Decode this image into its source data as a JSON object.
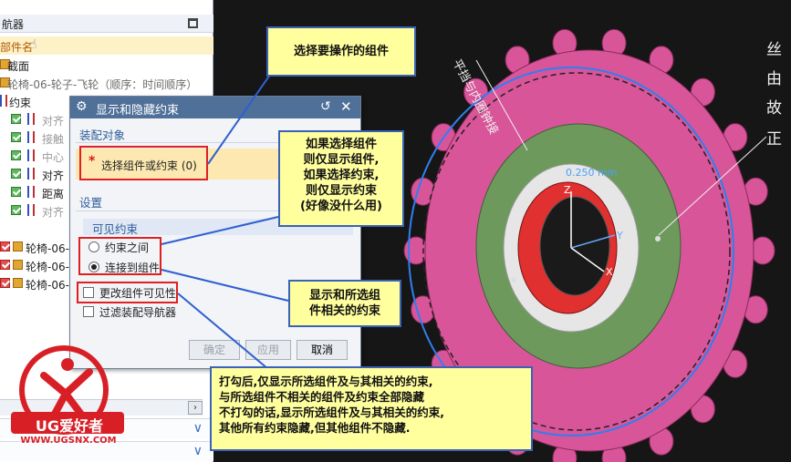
{
  "navigator": {
    "title": "航器",
    "rows": [
      {
        "label": "部件名"
      },
      {
        "label": "截面"
      },
      {
        "label": "轮椅-06-轮子-飞轮（顺序：时间顺序）"
      },
      {
        "label": "约束"
      },
      {
        "label": "对齐"
      },
      {
        "label": "接触"
      },
      {
        "label": "中心"
      },
      {
        "label": "对齐"
      },
      {
        "label": "距离"
      },
      {
        "label": "对齐"
      },
      {
        "label": "轮椅-06-"
      },
      {
        "label": "轮椅-06-"
      },
      {
        "label": "轮椅-06-"
      }
    ]
  },
  "dialog": {
    "title": "显示和隐藏约束",
    "section_assembly": "装配对象",
    "select_label": "选择组件或约束 (0)",
    "section_settings": "设置",
    "visible_constraints": "可见约束",
    "radio_between": "约束之间",
    "radio_connected": "连接到组件",
    "checkbox_change_visibility": "更改组件可见性",
    "checkbox_filter": "过滤装配导航器",
    "btn_ok": "确定",
    "btn_apply": "应用",
    "btn_cancel": "取消"
  },
  "callouts": {
    "c1": "选择要操作的组件",
    "c2": [
      "如果选择组件",
      "则仅显示组件,",
      "如果选择约束,",
      "则仅显示约束",
      "(好像没什么用)"
    ],
    "c3": [
      "显示和所选组",
      "件相关的约束"
    ],
    "c4": [
      "打勾后,仅显示所选组件及与其相关的约束,",
      "与所选组件不相关的组件及约束全部隐藏",
      "不打勾的话,显示所选组件及与其相关的约束,",
      "其他所有约束隐藏,但其他组件不隐藏."
    ]
  },
  "viewport": {
    "annotation_top": "平挡与内圈钟接",
    "dimension": "0.250 mm",
    "right_text": [
      "丝",
      "由",
      "故",
      "正"
    ]
  },
  "logo": {
    "brand": "UG爱好者",
    "url": "WWW.UGSNX.COM"
  },
  "colors": {
    "gear": "#d8559a",
    "ring": "#6d9a5c",
    "hub": "#e03030",
    "callout_bg": "#ffff9e",
    "callout_border": "#3a62b5",
    "highlight": "#e02020"
  }
}
